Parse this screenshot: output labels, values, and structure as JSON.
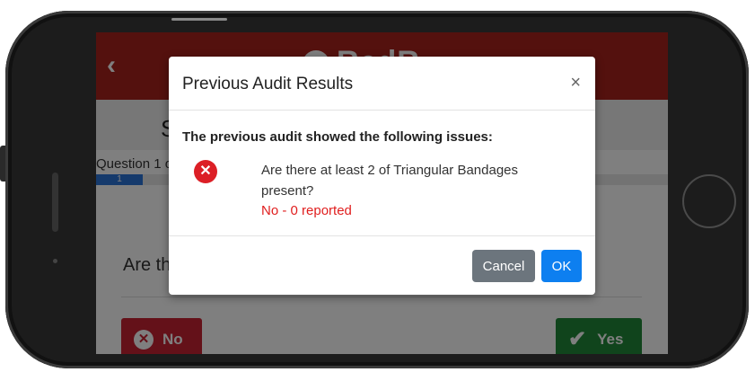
{
  "app": {
    "back_icon": "chevron-left-icon",
    "brand_name": "RedR",
    "section_title": "S",
    "question_counter": "Question 1 o",
    "progress_value": "1",
    "question_text": "Are the",
    "no_label": "No",
    "yes_label": "Yes",
    "colors": {
      "header": "#a8221d",
      "no": "#c82333",
      "yes": "#218838",
      "progress": "#2b74d8"
    }
  },
  "modal": {
    "title": "Previous Audit Results",
    "close_icon": "×",
    "intro": "The previous audit showed the following issues:",
    "issue": {
      "icon": "error-icon",
      "question": "Are there at least 2 of Triangular Bandages present?",
      "status": "No - 0 reported",
      "status_color": "#e01e1e"
    },
    "cancel_label": "Cancel",
    "ok_label": "OK"
  }
}
